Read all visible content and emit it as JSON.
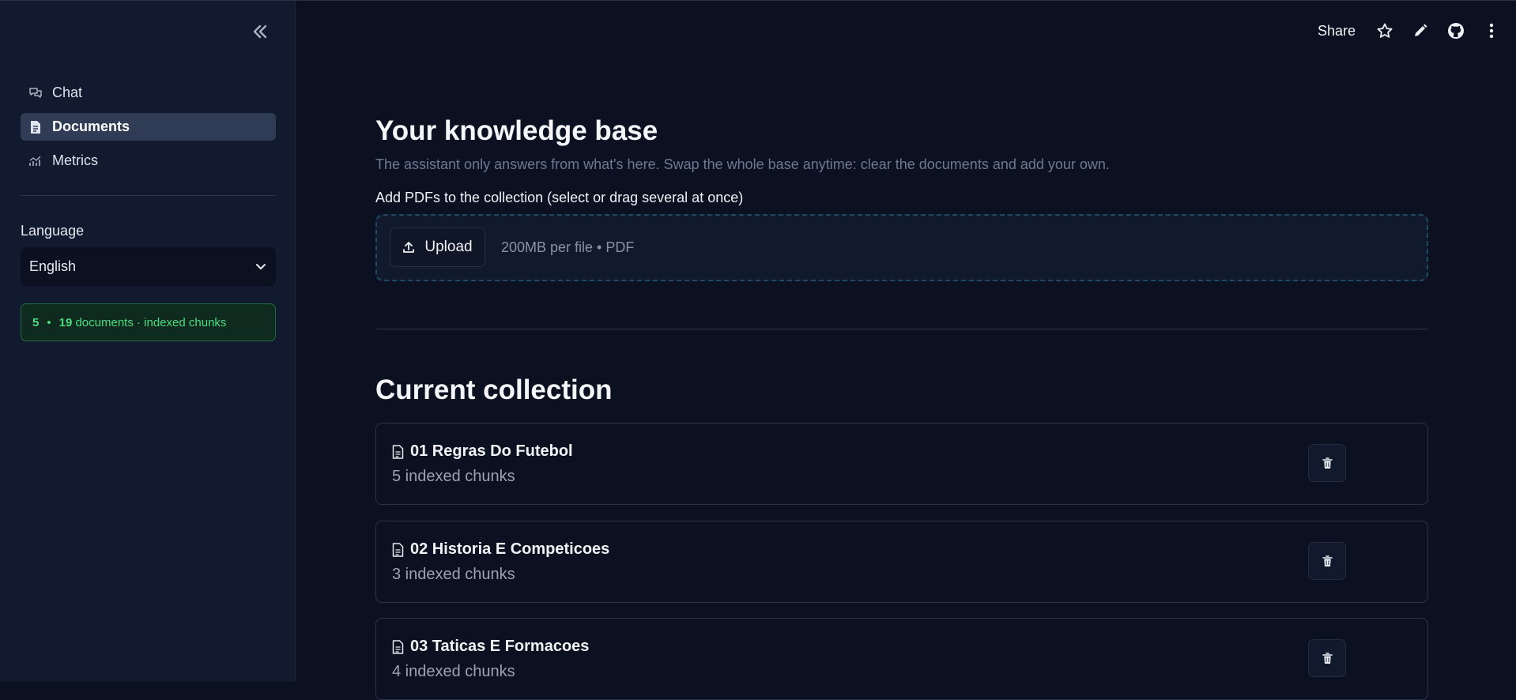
{
  "sidebar": {
    "collapse_label": "«",
    "nav": [
      {
        "label": "Chat",
        "icon": "chat-icon",
        "active": false
      },
      {
        "label": "Documents",
        "icon": "document-icon",
        "active": true
      },
      {
        "label": "Metrics",
        "icon": "chart-icon",
        "active": false
      }
    ],
    "language_label": "Language",
    "language_value": "English",
    "status": {
      "docs": "5",
      "sep": "•",
      "chunks": "19",
      "text": "documents · indexed chunks"
    }
  },
  "header": {
    "share_label": "Share",
    "icons": [
      "star-icon",
      "edit-icon",
      "github-icon",
      "more-vertical-icon"
    ]
  },
  "main": {
    "title": "Your knowledge base",
    "subtitle": "The assistant only answers from what's here. Swap the whole base anytime: clear the documents and add your own.",
    "upload_label": "Add PDFs to the collection (select or drag several at once)",
    "upload_button": "Upload",
    "upload_hint": "200MB per file • PDF",
    "collection_title": "Current collection",
    "documents": [
      {
        "name": "01 Regras Do Futebol",
        "chunks": "5 indexed chunks"
      },
      {
        "name": "02 Historia E Competicoes",
        "chunks": "3 indexed chunks"
      },
      {
        "name": "03 Taticas E Formacoes",
        "chunks": "4 indexed chunks"
      }
    ]
  },
  "colors": {
    "background": "#0b1120",
    "sidebar": "#111a2e",
    "active_nav": "#303c55",
    "status_green": "#4ade80",
    "dropzone_border": "#1e4a63"
  }
}
